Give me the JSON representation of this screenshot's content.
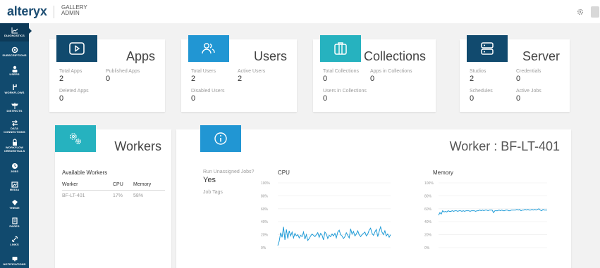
{
  "header": {
    "logo": "alteryx",
    "subtitle_line1": "GALLERY",
    "subtitle_line2": "ADMIN"
  },
  "sidebar": {
    "items": [
      {
        "label": "DIAGNOSTICS",
        "icon": "chart-icon",
        "active": true
      },
      {
        "label": "SUBSCRIPTIONS",
        "icon": "subscriptions-icon"
      },
      {
        "label": "USERS",
        "icon": "user-icon"
      },
      {
        "label": "WORKFLOWS",
        "icon": "workflows-icon"
      },
      {
        "label": "DISTRICTS",
        "icon": "signpost-icon"
      },
      {
        "label_line1": "DATA",
        "label_line2": "CONNECTIONS",
        "icon": "arrows-icon"
      },
      {
        "label_line1": "WORKFLOW",
        "label_line2": "CREDENTIALS",
        "icon": "lock-icon"
      },
      {
        "label": "JOBS",
        "icon": "jobs-icon"
      },
      {
        "label": "MEDIA",
        "icon": "media-icon"
      },
      {
        "label": "THEME",
        "icon": "theme-icon"
      },
      {
        "label": "PAGES",
        "icon": "pages-icon"
      },
      {
        "label": "LINKS",
        "icon": "link-icon"
      },
      {
        "label": "NOTIFICATIONS",
        "icon": "notifications-icon"
      }
    ]
  },
  "colors": {
    "nav": "#114a6e",
    "apps_tile": "#114a6e",
    "users_tile": "#2196d3",
    "collections_tile": "#26b2bf",
    "server_tile": "#114a6e",
    "workers_tile": "#26b2bf",
    "detail_tile": "#2196d3",
    "series_line": "#1e9bd7"
  },
  "cards": {
    "apps": {
      "title": "Apps",
      "stats": [
        {
          "label": "Total Apps",
          "value": "2"
        },
        {
          "label": "Published Apps",
          "value": "0"
        },
        {
          "label": "Deleted Apps",
          "value": "0"
        }
      ]
    },
    "users": {
      "title": "Users",
      "stats": [
        {
          "label": "Total Users",
          "value": "2"
        },
        {
          "label": "Active Users",
          "value": "2"
        },
        {
          "label": "Disabled Users",
          "value": "0"
        }
      ]
    },
    "collections": {
      "title": "Collections",
      "stats": [
        {
          "label": "Total Collections",
          "value": "0"
        },
        {
          "label": "Apps in Collections",
          "value": "0"
        },
        {
          "label": "Users in Collections",
          "value": "0"
        }
      ]
    },
    "server": {
      "title": "Server",
      "stats": [
        {
          "label": "Studios",
          "value": "2"
        },
        {
          "label": "Credentials",
          "value": "0"
        },
        {
          "label": "Schedules",
          "value": "0"
        },
        {
          "label": "Active Jobs",
          "value": "0"
        }
      ]
    },
    "workers": {
      "title": "Workers",
      "heading": "Available Workers",
      "columns": [
        "Worker",
        "CPU",
        "Memory"
      ],
      "rows": [
        {
          "worker": "BF-LT-401",
          "cpu": "17%",
          "memory": "58%"
        }
      ]
    },
    "detail": {
      "title": "Worker : BF-LT-401",
      "run_unassigned_label": "Run Unassigned Jobs?",
      "run_unassigned_value": "Yes",
      "job_tags_label": "Job Tags"
    }
  },
  "chart_data": [
    {
      "type": "line",
      "title": "CPU",
      "ylim": [
        0,
        100
      ],
      "y_ticks": [
        "0%",
        "20%",
        "40%",
        "60%",
        "80%",
        "100%"
      ],
      "grid": true,
      "series": [
        {
          "values": [
            3,
            10,
            23,
            16,
            32,
            12,
            28,
            14,
            26,
            18,
            24,
            15,
            22,
            18,
            20,
            15,
            19,
            17,
            24,
            13,
            20,
            11,
            14,
            18,
            21,
            19,
            17,
            20,
            23,
            16,
            22,
            19,
            12,
            24,
            21,
            14,
            19,
            17,
            21,
            18,
            22,
            15,
            24,
            27,
            20,
            18,
            14,
            17,
            23,
            19,
            15,
            29,
            21,
            25,
            18,
            21,
            26,
            20,
            17,
            20,
            22,
            24,
            18,
            21,
            27,
            30,
            22,
            19,
            24,
            28,
            17,
            25,
            32,
            24,
            20,
            26,
            18,
            21,
            16,
            20
          ]
        }
      ]
    },
    {
      "type": "line",
      "title": "Memory",
      "ylim": [
        0,
        100
      ],
      "y_ticks": [
        "0%",
        "20%",
        "40%",
        "60%",
        "80%",
        "100%"
      ],
      "grid": true,
      "series": [
        {
          "values": [
            50,
            54,
            52,
            57,
            55,
            56,
            55,
            57,
            56,
            56,
            57,
            56,
            57,
            57,
            56,
            57,
            57,
            56,
            57,
            56,
            57,
            57,
            57,
            56,
            57,
            57,
            57,
            56,
            57,
            57,
            58,
            57,
            58,
            57,
            58,
            58,
            57,
            58,
            58,
            58,
            54,
            57,
            57,
            57,
            58,
            57,
            58,
            57,
            57,
            58,
            58,
            57,
            57,
            58,
            58,
            58,
            58,
            59,
            58,
            59,
            57,
            58,
            58,
            59,
            58,
            59,
            58,
            58,
            59,
            58,
            59,
            58,
            59,
            60,
            58,
            57,
            59,
            58,
            58,
            58
          ]
        }
      ]
    }
  ]
}
